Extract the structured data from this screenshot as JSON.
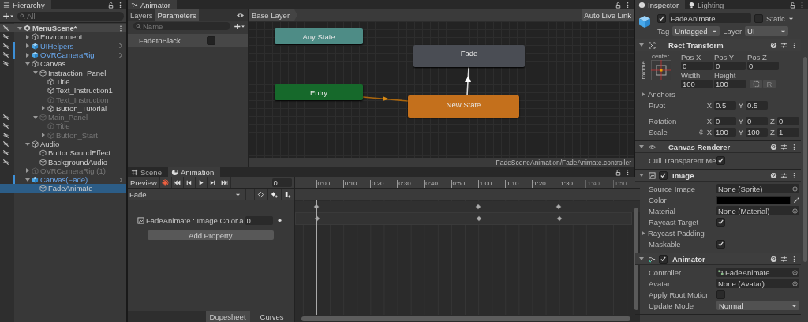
{
  "hierarchy": {
    "title": "Hierarchy",
    "search": {
      "placeholder": "All"
    },
    "items": [
      {
        "name": "MenuScene*",
        "kind": "scene",
        "expanded": true,
        "active": true,
        "hidden": true,
        "selected": false,
        "children": [
          {
            "name": "Environment",
            "kind": "object",
            "expanded": false,
            "active": true,
            "hidden": true,
            "selected": false
          },
          {
            "name": "UIHelpers",
            "kind": "prefab",
            "expanded": false,
            "active": true,
            "hidden": true,
            "selected": false
          },
          {
            "name": "OVRCameraRig",
            "kind": "prefab",
            "expanded": false,
            "active": true,
            "hidden": true,
            "selected": false
          },
          {
            "name": "Canvas",
            "kind": "object",
            "expanded": true,
            "active": true,
            "hidden": true,
            "selected": false,
            "children": [
              {
                "name": "Instraction_Panel",
                "kind": "object",
                "expanded": true,
                "active": true,
                "hidden": false,
                "selected": false,
                "children": [
                  {
                    "name": "Title",
                    "kind": "object",
                    "active": true,
                    "hidden": false,
                    "selected": false
                  },
                  {
                    "name": "Text_Instruction1",
                    "kind": "object",
                    "active": true,
                    "hidden": false,
                    "selected": false
                  },
                  {
                    "name": "Text_Instruction",
                    "kind": "object",
                    "active": false,
                    "hidden": false,
                    "selected": false
                  },
                  {
                    "name": "Button_Tutorial",
                    "kind": "object",
                    "expanded": false,
                    "active": true,
                    "hidden": false,
                    "selected": false
                  }
                ]
              },
              {
                "name": "Main_Panel",
                "kind": "object",
                "expanded": true,
                "active": false,
                "hidden": true,
                "selected": false,
                "children": [
                  {
                    "name": "Title",
                    "kind": "object",
                    "active": false,
                    "hidden": true,
                    "selected": false
                  },
                  {
                    "name": "Button_Start",
                    "kind": "object",
                    "expanded": false,
                    "active": false,
                    "hidden": true,
                    "selected": false
                  }
                ]
              }
            ]
          },
          {
            "name": "Audio",
            "kind": "object",
            "expanded": true,
            "active": true,
            "hidden": true,
            "selected": false,
            "children": [
              {
                "name": "ButtonSoundEffect",
                "kind": "object",
                "active": true,
                "hidden": true,
                "selected": false
              },
              {
                "name": "BackgroundAudio",
                "kind": "object",
                "active": true,
                "hidden": true,
                "selected": false
              }
            ]
          },
          {
            "name": "OVRCameraRig (1)",
            "kind": "object",
            "expanded": false,
            "active": false,
            "hidden": false,
            "selected": false
          },
          {
            "name": "Canvas(Fade)",
            "kind": "prefab",
            "expanded": true,
            "active": true,
            "hidden": false,
            "selected": false,
            "children": [
              {
                "name": "FadeAnimate",
                "kind": "object",
                "active": true,
                "hidden": false,
                "selected": true
              }
            ]
          }
        ]
      }
    ]
  },
  "animator": {
    "title": "Animator",
    "tabs": [
      {
        "label": "Layers",
        "selected": false
      },
      {
        "label": "Parameters",
        "selected": true
      }
    ],
    "search": {
      "placeholder": "Name"
    },
    "parameters": [
      {
        "name": "FadetoBlack",
        "kind": "bool",
        "value": false
      }
    ],
    "breadcrumb": "Base Layer",
    "live_link": "Auto Live Link",
    "states": [
      {
        "name": "Any State",
        "kind": "any"
      },
      {
        "name": "Fade",
        "kind": "state"
      },
      {
        "name": "Entry",
        "kind": "entry"
      },
      {
        "name": "New State",
        "kind": "default"
      }
    ],
    "path": "FadeSceneAnimation/FadeAnimate.controller"
  },
  "animation": {
    "tabs": [
      {
        "label": "Scene",
        "kind": "scene",
        "selected": false
      },
      {
        "label": "Animation",
        "kind": "animation",
        "selected": true
      }
    ],
    "preview": "Preview",
    "frame": "0",
    "clip": "Fade",
    "properties": [
      {
        "name": "FadeAnimate : Image.Color.a",
        "value": "0"
      }
    ],
    "add_property": "Add Property",
    "ticks": [
      {
        "label": "0:00",
        "in_range": true
      },
      {
        "label": "0:10",
        "in_range": true
      },
      {
        "label": "0:20",
        "in_range": true
      },
      {
        "label": "0:30",
        "in_range": true
      },
      {
        "label": "0:40",
        "in_range": true
      },
      {
        "label": "0:50",
        "in_range": true
      },
      {
        "label": "1:00",
        "in_range": true
      },
      {
        "label": "1:10",
        "in_range": true
      },
      {
        "label": "1:20",
        "in_range": true
      },
      {
        "label": "1:30",
        "in_range": true
      },
      {
        "label": "1:40",
        "in_range": false
      },
      {
        "label": "1:50",
        "in_range": false
      }
    ],
    "view_tabs": [
      {
        "label": "Dopesheet",
        "selected": true
      },
      {
        "label": "Curves",
        "selected": false
      }
    ]
  },
  "inspector": {
    "tabs": [
      {
        "label": "Inspector",
        "kind": "info",
        "selected": true
      },
      {
        "label": "Lighting",
        "kind": "light",
        "selected": false
      }
    ],
    "object": {
      "active": true,
      "name": "FadeAnimate",
      "static_label": "Static",
      "static": false,
      "tag_label": "Tag",
      "tag": "Untagged",
      "layer_label": "Layer",
      "layer": "UI"
    },
    "components": [
      {
        "kind": "rect",
        "title": "Rect Transform",
        "expanded": true,
        "anchor_h": "center",
        "anchor_v": "middle",
        "grid": [
          {
            "label": "Pos X",
            "value": "0"
          },
          {
            "label": "Pos Y",
            "value": "0"
          },
          {
            "label": "Pos Z",
            "value": "0"
          },
          {
            "label": "Width",
            "value": "100"
          },
          {
            "label": "Height",
            "value": "100"
          }
        ],
        "raw_button": "R",
        "rows": [
          {
            "kind": "foldout",
            "label": "Anchors"
          },
          {
            "kind": "vector",
            "label": "Pivot",
            "axes": [
              {
                "axis": "X",
                "value": "0.5"
              },
              {
                "axis": "Y",
                "value": "0.5"
              }
            ]
          },
          {
            "kind": "vector",
            "label": "Rotation",
            "axes": [
              {
                "axis": "X",
                "value": "0"
              },
              {
                "axis": "Y",
                "value": "0"
              },
              {
                "axis": "Z",
                "value": "0"
              }
            ]
          },
          {
            "kind": "vector_link",
            "label": "Scale",
            "axes": [
              {
                "axis": "X",
                "value": "100"
              },
              {
                "axis": "Y",
                "value": "100"
              },
              {
                "axis": "Z",
                "value": "1"
              }
            ]
          }
        ]
      },
      {
        "kind": "canvas_renderer",
        "title": "Canvas Renderer",
        "expanded": true,
        "rows": [
          {
            "kind": "check",
            "label": "Cull Transparent Me",
            "checked": true
          }
        ]
      },
      {
        "kind": "image",
        "title": "Image",
        "expanded": true,
        "enabled": true,
        "rows": [
          {
            "kind": "object",
            "label": "Source Image",
            "value": "None (Sprite)"
          },
          {
            "kind": "color",
            "label": "Color",
            "color": "#000000"
          },
          {
            "kind": "object",
            "label": "Material",
            "value": "None (Material)"
          },
          {
            "kind": "check",
            "label": "Raycast Target",
            "checked": true
          },
          {
            "kind": "foldout",
            "label": "Raycast Padding"
          },
          {
            "kind": "check",
            "label": "Maskable",
            "checked": true
          }
        ]
      },
      {
        "kind": "animator",
        "title": "Animator",
        "expanded": true,
        "enabled": true,
        "rows": [
          {
            "kind": "asset",
            "label": "Controller",
            "value": "FadeAnimate"
          },
          {
            "kind": "object",
            "label": "Avatar",
            "value": "None (Avatar)"
          },
          {
            "kind": "check",
            "label": "Apply Root Motion",
            "checked": false
          },
          {
            "kind": "dropdown",
            "label": "Update Mode",
            "value": "Normal"
          }
        ]
      }
    ]
  }
}
